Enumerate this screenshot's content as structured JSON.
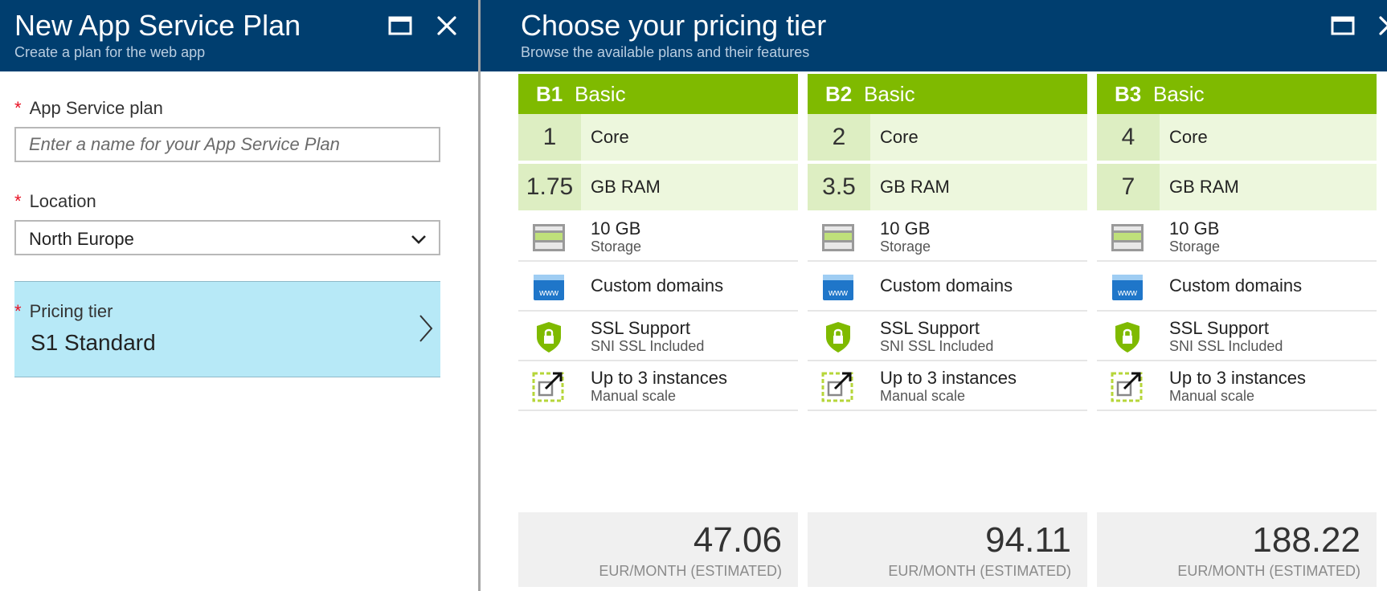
{
  "left_blade": {
    "title": "New App Service Plan",
    "subtitle": "Create a plan for the web app",
    "fields": {
      "plan_label": "App Service plan",
      "plan_placeholder": "Enter a name for your App Service Plan",
      "location_label": "Location",
      "location_value": "North Europe",
      "pricing_label": "Pricing tier",
      "pricing_value": "S1 Standard"
    },
    "required_marker": "*"
  },
  "right_blade": {
    "title": "Choose your pricing tier",
    "subtitle": "Browse the available plans and their features"
  },
  "tiers": [
    {
      "code": "B1",
      "name": "Basic",
      "cores": "1",
      "cores_unit": "Core",
      "ram": "1.75",
      "ram_unit": "GB RAM",
      "storage": "10 GB",
      "storage_sub": "Storage",
      "domains": "Custom domains",
      "ssl": "SSL Support",
      "ssl_sub": "SNI SSL Included",
      "scale": "Up to 3 instances",
      "scale_sub": "Manual scale",
      "price": "47.06",
      "price_unit": "EUR/MONTH (ESTIMATED)"
    },
    {
      "code": "B2",
      "name": "Basic",
      "cores": "2",
      "cores_unit": "Core",
      "ram": "3.5",
      "ram_unit": "GB RAM",
      "storage": "10 GB",
      "storage_sub": "Storage",
      "domains": "Custom domains",
      "ssl": "SSL Support",
      "ssl_sub": "SNI SSL Included",
      "scale": "Up to 3 instances",
      "scale_sub": "Manual scale",
      "price": "94.11",
      "price_unit": "EUR/MONTH (ESTIMATED)"
    },
    {
      "code": "B3",
      "name": "Basic",
      "cores": "4",
      "cores_unit": "Core",
      "ram": "7",
      "ram_unit": "GB RAM",
      "storage": "10 GB",
      "storage_sub": "Storage",
      "domains": "Custom domains",
      "ssl": "SSL Support",
      "ssl_sub": "SNI SSL Included",
      "scale": "Up to 3 instances",
      "scale_sub": "Manual scale",
      "price": "188.22",
      "price_unit": "EUR/MONTH (ESTIMATED)"
    }
  ],
  "icons": {
    "maximize": "maximize-icon",
    "close": "close-icon",
    "dropdown": "chevron-down-icon",
    "navigate": "chevron-right-icon",
    "storage": "storage-icon",
    "domains": "www-globe-icon",
    "ssl": "shield-lock-icon",
    "scale": "scale-out-icon"
  },
  "colors": {
    "header_bg": "#003e6f",
    "tier_accent": "#7fba00",
    "selected_row": "#b7e9f7",
    "required": "#e81123"
  }
}
